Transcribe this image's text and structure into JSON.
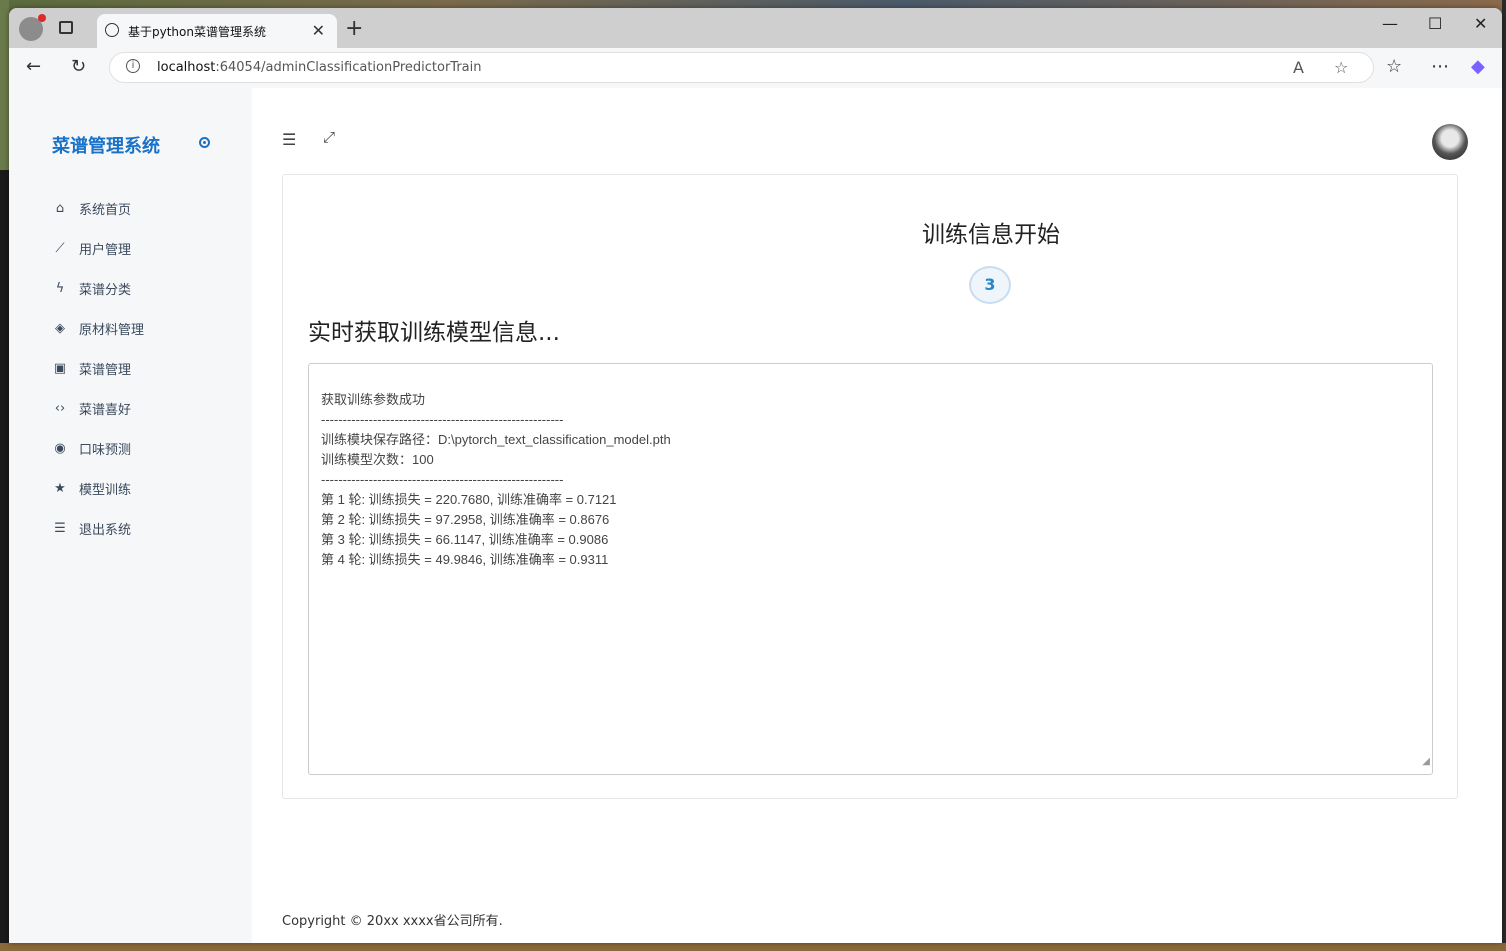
{
  "browser": {
    "tab_title": "基于python菜谱管理系统",
    "url_host": "localhost",
    "url_path": ":64054/adminClassificationPredictorTrain"
  },
  "sidebar": {
    "brand": "菜谱管理系统",
    "items": [
      {
        "label": "系统首页",
        "icon": "home-icon"
      },
      {
        "label": "用户管理",
        "icon": "line-chart-icon"
      },
      {
        "label": "菜谱分类",
        "icon": "bolt-icon"
      },
      {
        "label": "原材料管理",
        "icon": "layers-icon"
      },
      {
        "label": "菜谱管理",
        "icon": "inbox-icon"
      },
      {
        "label": "菜谱喜好",
        "icon": "code-icon"
      },
      {
        "label": "口味预测",
        "icon": "target-icon"
      },
      {
        "label": "模型训练",
        "icon": "star-icon"
      },
      {
        "label": "退出系统",
        "icon": "list-icon"
      }
    ]
  },
  "main": {
    "title": "训练信息开始",
    "badge": "3",
    "realtime_title": "实时获取训练模型信息...",
    "log_lines": [
      "获取训练参数成功",
      "--------------------------------------------------------",
      "训练模块保存路径：D:\\pytorch_text_classification_model.pth",
      "训练模型次数：100",
      "--------------------------------------------------------",
      "第 1 轮: 训练损失 = 220.7680, 训练准确率 = 0.7121",
      "第 2 轮: 训练损失 = 97.2958, 训练准确率 = 0.8676",
      "第 3 轮: 训练损失 = 66.1147, 训练准确率 = 0.9086",
      "第 4 轮: 训练损失 = 49.9846, 训练准确率 = 0.9311"
    ],
    "footer": "Copyright © 20xx xxxx省公司所有."
  },
  "colors": {
    "brand": "#1a72c8",
    "badge_text": "#2a86c9"
  }
}
